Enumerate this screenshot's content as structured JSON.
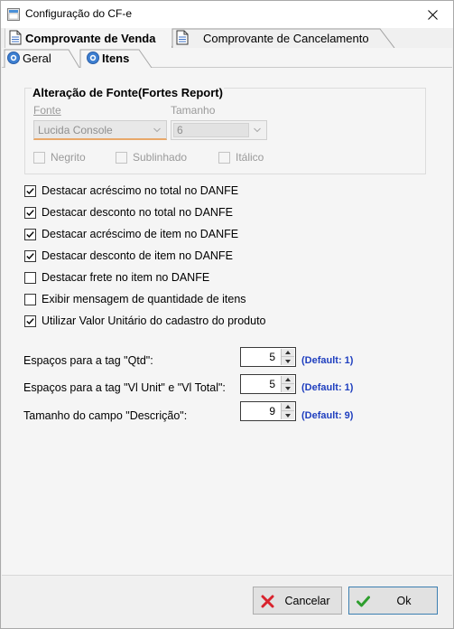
{
  "window": {
    "title": "Configuração do CF-e"
  },
  "tabs": [
    {
      "label": "Comprovante de Venda",
      "icon": "document-icon",
      "active": true
    },
    {
      "label": "Comprovante de Cancelamento",
      "icon": "document-icon",
      "active": false
    }
  ],
  "subtabs": [
    {
      "label": "Geral",
      "icon": "gear-icon",
      "active": false
    },
    {
      "label": "Itens",
      "icon": "gear-icon",
      "active": true
    }
  ],
  "font_group": {
    "title": "Alteração de Fonte(Fortes Report)",
    "fonte_label": "Fonte",
    "fonte_value": "Lucida Console",
    "tamanho_label": "Tamanho",
    "tamanho_value": "6",
    "negrito_label": "Negrito",
    "sublinhado_label": "Sublinhado",
    "italico_label": "Itálico"
  },
  "options": [
    {
      "label": "Destacar acréscimo no total no DANFE",
      "checked": true
    },
    {
      "label": "Destacar desconto no total no DANFE",
      "checked": true
    },
    {
      "label": "Destacar acréscimo de item no DANFE",
      "checked": true
    },
    {
      "label": "Destacar desconto de item no DANFE",
      "checked": true
    },
    {
      "label": "Destacar frete no item no DANFE",
      "checked": false
    },
    {
      "label": "Exibir mensagem de quantidade de itens",
      "checked": false
    },
    {
      "label": "Utilizar Valor Unitário do cadastro do produto",
      "checked": true
    }
  ],
  "spinners": [
    {
      "label": "Espaços para a tag \"Qtd\":",
      "value": "5",
      "default": "(Default: 1)"
    },
    {
      "label": "Espaços para a tag \"Vl Unit\" e \"Vl Total\":",
      "value": "5",
      "default": "(Default: 1)"
    },
    {
      "label": "Tamanho do campo \"Descrição\":",
      "value": "9",
      "default": "(Default: 9)"
    }
  ],
  "buttons": {
    "cancel_label": "Cancelar",
    "ok_label": "Ok"
  },
  "colors": {
    "default_text": "#1f3fbf",
    "cancel_icon": "#d9232d",
    "ok_icon": "#2e9e2e"
  }
}
